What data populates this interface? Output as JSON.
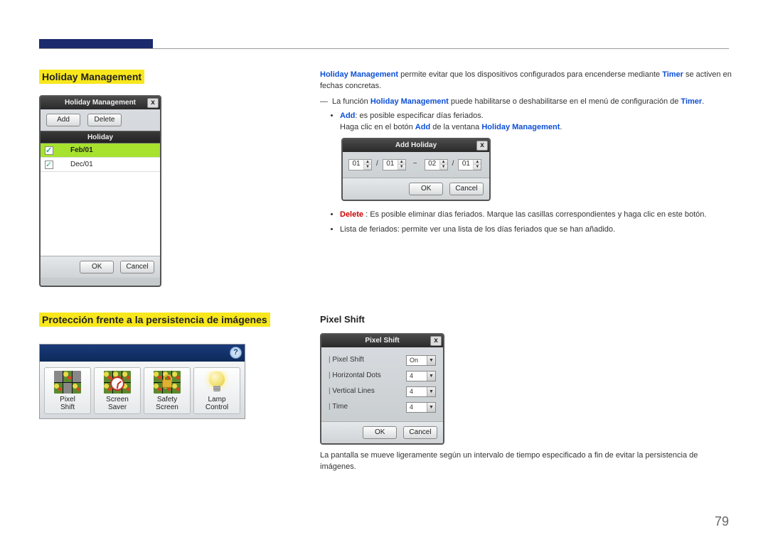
{
  "page_number": "79",
  "headings": {
    "holiday_management": "Holiday Management",
    "protection": "Protección frente a la persistencia de imágenes",
    "pixel_shift_heading": "Pixel Shift"
  },
  "right_text": {
    "intro_a": "Holiday Management",
    "intro_b": " permite evitar que los dispositivos configurados para encenderse mediante ",
    "intro_c": "Timer",
    "intro_d": " se activen en fechas concretas.",
    "dash_a": "La función ",
    "dash_b": "Holiday Management",
    "dash_c": " puede habilitarse o deshabilitarse en el menú de configuración de ",
    "dash_d": "Timer",
    "dash_e": ".",
    "add_a": "Add",
    "add_b": ": es posible especificar días feriados.",
    "add_line2a": "Haga clic en el botón ",
    "add_line2b": "Add",
    "add_line2c": " de la ventana ",
    "add_line2d": "Holiday Management",
    "add_line2e": ".",
    "delete_a": "Delete",
    "delete_b": " : Es posible eliminar días feriados. Marque las casillas correspondientes y haga clic en este botón.",
    "list": "Lista de feriados: permite ver una lista de los días feriados que se han añadido.",
    "pixel_shift_desc": "La pantalla se mueve ligeramente según un intervalo de tiempo especificado a fin de evitar la persistencia de imágenes."
  },
  "hm_dialog": {
    "title": "Holiday Management",
    "close": "x",
    "add_btn": "Add",
    "delete_btn": "Delete",
    "col_header": "Holiday",
    "rows": [
      {
        "checked": true,
        "label": "Feb/01",
        "selected": true
      },
      {
        "checked": true,
        "label": "Dec/01",
        "selected": false
      }
    ],
    "ok": "OK",
    "cancel": "Cancel"
  },
  "add_holiday": {
    "title": "Add Holiday",
    "close": "x",
    "m1": "01",
    "d1": "01",
    "m2": "02",
    "d2": "01",
    "ok": "OK",
    "cancel": "Cancel"
  },
  "pixel_shift": {
    "title": "Pixel Shift",
    "close": "x",
    "rows": {
      "pixel_shift_lbl": "Pixel Shift",
      "pixel_shift_val": "On",
      "hdots_lbl": "Horizontal Dots",
      "hdots_val": "4",
      "vlines_lbl": "Vertical Lines",
      "vlines_val": "4",
      "time_lbl": "Time",
      "time_val": "4"
    },
    "ok": "OK",
    "cancel": "Cancel"
  },
  "prot_toolbar": {
    "help": "?",
    "items": {
      "pixel_shift_l1": "Pixel",
      "pixel_shift_l2": "Shift",
      "screen_saver_l1": "Screen",
      "screen_saver_l2": "Saver",
      "safety_screen_l1": "Safety",
      "safety_screen_l2": "Screen",
      "lamp_control_l1": "Lamp",
      "lamp_control_l2": "Control"
    }
  }
}
